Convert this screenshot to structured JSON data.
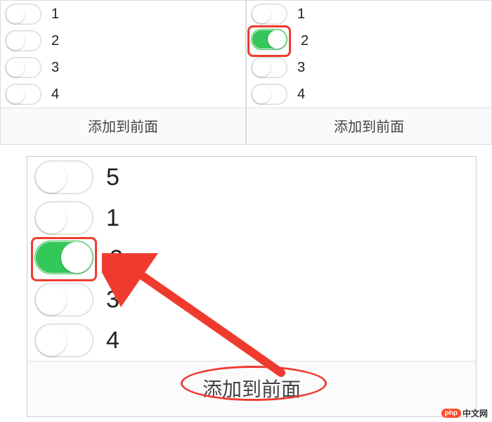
{
  "panels": {
    "topLeft": {
      "items": [
        {
          "label": "1",
          "on": false,
          "highlight": false
        },
        {
          "label": "2",
          "on": false,
          "highlight": false
        },
        {
          "label": "3",
          "on": false,
          "highlight": false
        },
        {
          "label": "4",
          "on": false,
          "highlight": false
        }
      ],
      "button": "添加到前面"
    },
    "topRight": {
      "items": [
        {
          "label": "1",
          "on": false,
          "highlight": false
        },
        {
          "label": "2",
          "on": true,
          "highlight": true
        },
        {
          "label": "3",
          "on": false,
          "highlight": false
        },
        {
          "label": "4",
          "on": false,
          "highlight": false
        }
      ],
      "button": "添加到前面"
    },
    "bottom": {
      "items": [
        {
          "label": "5",
          "on": false,
          "highlight": false
        },
        {
          "label": "1",
          "on": false,
          "highlight": false
        },
        {
          "label": "2",
          "on": true,
          "highlight": true
        },
        {
          "label": "3",
          "on": false,
          "highlight": false
        },
        {
          "label": "4",
          "on": false,
          "highlight": false
        }
      ],
      "button": "添加到前面",
      "buttonHighlight": true
    }
  },
  "watermark": {
    "badge": "php",
    "text": "中文网"
  }
}
